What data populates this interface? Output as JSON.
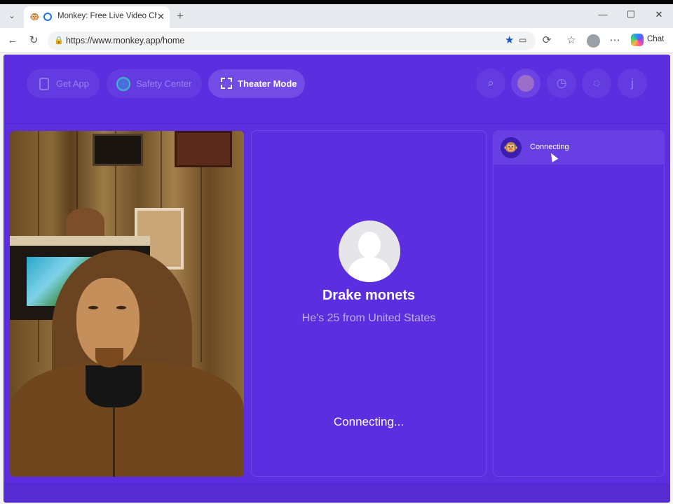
{
  "browser": {
    "tab_title": "Monkey: Free Live Video Cha",
    "url": "https://www.monkey.app/home",
    "chat_label": "Chat"
  },
  "nav": {
    "get_app": "Get App",
    "safety_center": "Safety Center",
    "theater_mode": "Theater Mode"
  },
  "header_icons": [
    "search-icon",
    "avatar",
    "history-icon",
    "messages-icon",
    "profile-icon"
  ],
  "profile_initial": "j",
  "match": {
    "name": "Drake monets",
    "subtitle": "He's 25 from United States",
    "status": "Connecting..."
  },
  "chat": {
    "items": [
      {
        "text": "Connecting"
      }
    ]
  },
  "colors": {
    "brand": "#5b2fe0"
  }
}
